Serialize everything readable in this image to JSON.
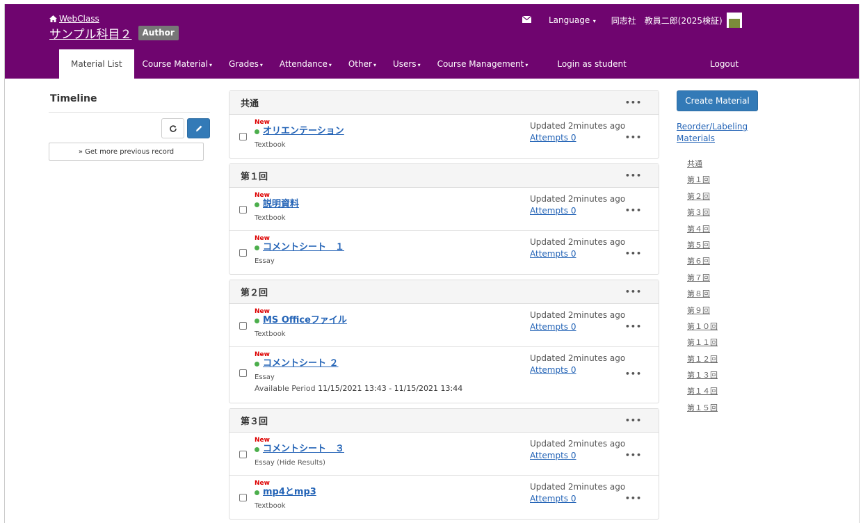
{
  "header": {
    "home_link": "WebClass",
    "course_title": "サンプル科目２",
    "role_badge": "Author",
    "language": "Language",
    "user_name": "同志社　教員二郎(2025検証)",
    "logout": "Logout",
    "accent_color": "#6f056f"
  },
  "nav": {
    "material_list": "Material List",
    "course_material": "Course Material",
    "grades": "Grades",
    "attendance": "Attendance",
    "other": "Other",
    "users": "Users",
    "course_management": "Course Management",
    "login_as_student": "Login as student"
  },
  "timeline": {
    "title": "Timeline",
    "more_button": "» Get more previous record"
  },
  "sections": [
    {
      "title": "共通",
      "items": [
        {
          "badge": "New",
          "title": "オリエンテーション",
          "kind": "Textbook",
          "updated": "Updated 2minutes ago",
          "attempts": "Attempts 0"
        }
      ]
    },
    {
      "title": "第１回",
      "items": [
        {
          "badge": "New",
          "title": "説明資料",
          "kind": "Textbook",
          "updated": "Updated 2minutes ago",
          "attempts": "Attempts 0"
        },
        {
          "badge": "New",
          "title": "コメントシート　１",
          "kind": "Essay",
          "updated": "Updated 2minutes ago",
          "attempts": "Attempts 0"
        }
      ]
    },
    {
      "title": "第２回",
      "items": [
        {
          "badge": "New",
          "title": "MS Officeファイル",
          "kind": "Textbook",
          "updated": "Updated 2minutes ago",
          "attempts": "Attempts 0"
        },
        {
          "badge": "New",
          "title": "コメントシート ２",
          "kind": "Essay",
          "period_label": "Available Period",
          "period_value": "11/15/2021 13:43 - 11/15/2021 13:44",
          "updated": "Updated 2minutes ago",
          "attempts": "Attempts 0"
        }
      ]
    },
    {
      "title": "第３回",
      "items": [
        {
          "badge": "New",
          "title": "コメントシート　３",
          "kind": "Essay (Hide Results)",
          "updated": "Updated 2minutes ago",
          "attempts": "Attempts 0"
        },
        {
          "badge": "New",
          "title": "mp4とmp3",
          "kind": "Textbook",
          "updated": "Updated 2minutes ago",
          "attempts": "Attempts 0"
        }
      ]
    }
  ],
  "sidebar": {
    "create_button": "Create Material",
    "reorder_link": "Reorder/Labeling Materials",
    "toc": [
      "共通",
      "第１回",
      "第２回",
      "第３回",
      "第４回",
      "第５回",
      "第６回",
      "第７回",
      "第８回",
      "第９回",
      "第１０回",
      "第１１回",
      "第１２回",
      "第１３回",
      "第１４回",
      "第１５回"
    ]
  }
}
